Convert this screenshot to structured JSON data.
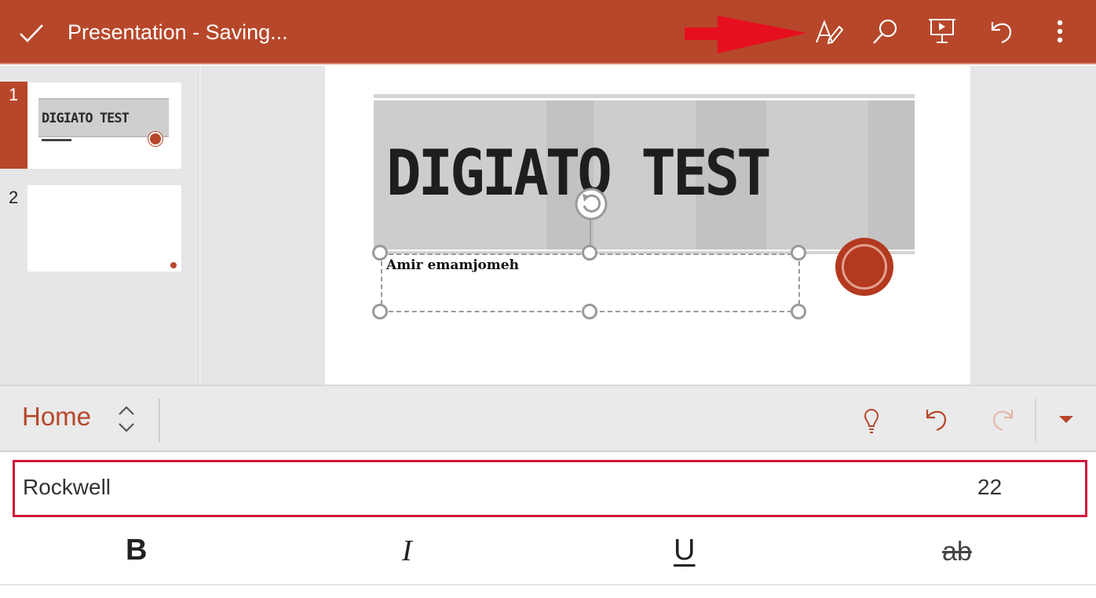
{
  "titlebar": {
    "title": "Presentation - Saving...",
    "accent_color": "#b7472a",
    "icons": [
      "check-icon",
      "pointer-arrow-icon",
      "edit-icon",
      "search-icon",
      "present-icon",
      "undo-icon",
      "more-icon"
    ]
  },
  "thumbnails": [
    {
      "number": "1",
      "text": "DIGIATO TEST",
      "selected": true
    },
    {
      "number": "2",
      "text": "",
      "selected": false
    }
  ],
  "slide": {
    "title": "DIGIATO TEST",
    "subtitle": "Amir emamjomeh"
  },
  "ribbon": {
    "tab_label": "Home",
    "icons": [
      "tab-switch-icon",
      "lightbulb-icon",
      "undo-icon",
      "redo-icon",
      "dropdown-icon"
    ]
  },
  "font": {
    "name": "Rockwell",
    "size": "22",
    "highlight_color": "#d3173a"
  },
  "format": {
    "bold": "B",
    "italic": "I",
    "underline": "U",
    "strikethrough": "ab"
  }
}
